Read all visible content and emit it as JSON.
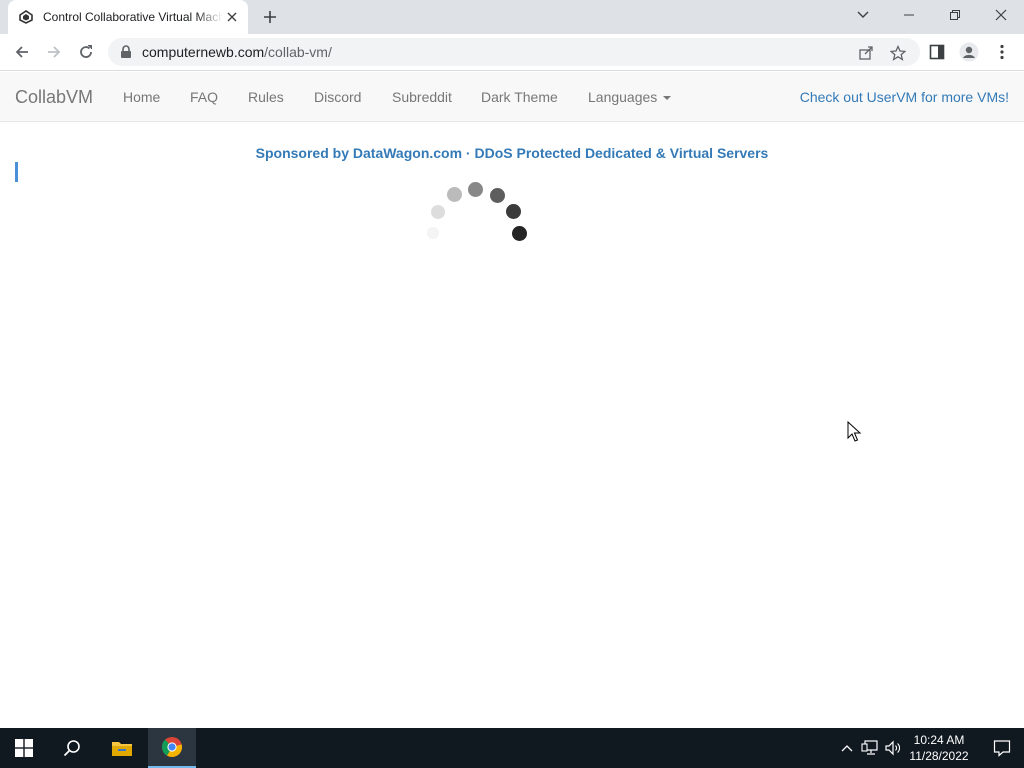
{
  "browser": {
    "tab_title": "Control Collaborative Virtual Machines!",
    "url_host": "computernewb.com",
    "url_path": "/collab-vm/"
  },
  "site": {
    "brand": "CollabVM",
    "nav": [
      "Home",
      "FAQ",
      "Rules",
      "Discord",
      "Subreddit",
      "Dark Theme"
    ],
    "languages": "Languages",
    "right_link": "Check out UserVM for more VMs!",
    "sponsor": "Sponsored by DataWagon.com · DDoS Protected Dedicated & Virtual Servers",
    "link_color": "#337ab7"
  },
  "taskbar": {
    "time": "10:24 AM",
    "date": "11/28/2022",
    "apps": [
      "start-icon",
      "search-icon",
      "file-explorer-icon",
      "chrome-icon"
    ]
  }
}
